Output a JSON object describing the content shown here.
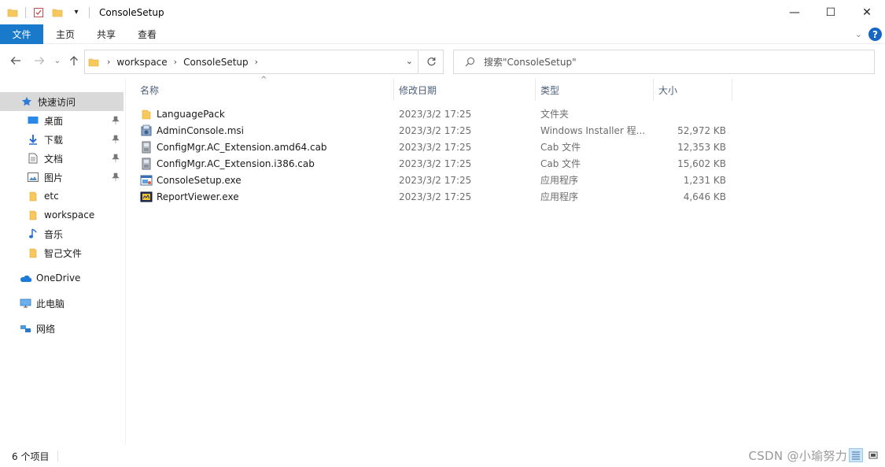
{
  "window": {
    "title": "ConsoleSetup",
    "controls": {
      "minimize": "—",
      "maximize": "☐",
      "close": "✕"
    }
  },
  "ribbon": {
    "tabs": [
      "文件",
      "主页",
      "共享",
      "查看"
    ],
    "help": "?"
  },
  "address": {
    "crumbs": [
      "workspace",
      "ConsoleSetup"
    ]
  },
  "search": {
    "placeholder": "搜索\"ConsoleSetup\""
  },
  "sidebar": {
    "quick_access": "快速访问",
    "pinned": [
      {
        "label": "桌面",
        "icon": "desktop-icon"
      },
      {
        "label": "下载",
        "icon": "download-icon"
      },
      {
        "label": "文档",
        "icon": "document-icon"
      },
      {
        "label": "图片",
        "icon": "pictures-icon"
      }
    ],
    "folders": [
      {
        "label": "etc",
        "icon": "folder-icon"
      },
      {
        "label": "workspace",
        "icon": "folder-icon"
      },
      {
        "label": "音乐",
        "icon": "music-icon"
      },
      {
        "label": "智己文件",
        "icon": "folder-icon"
      }
    ],
    "onedrive": "OneDrive",
    "this_pc": "此电脑",
    "network": "网络"
  },
  "columns": {
    "name": "名称",
    "modified": "修改日期",
    "type": "类型",
    "size": "大小"
  },
  "files": [
    {
      "name": "LanguagePack",
      "modified": "2023/3/2 17:25",
      "type": "文件夹",
      "size": "",
      "icon": "folder-icon"
    },
    {
      "name": "AdminConsole.msi",
      "modified": "2023/3/2 17:25",
      "type": "Windows Installer 程...",
      "size": "52,972 KB",
      "icon": "msi-installer-icon"
    },
    {
      "name": "ConfigMgr.AC_Extension.amd64.cab",
      "modified": "2023/3/2 17:25",
      "type": "Cab 文件",
      "size": "12,353 KB",
      "icon": "cab-archive-icon"
    },
    {
      "name": "ConfigMgr.AC_Extension.i386.cab",
      "modified": "2023/3/2 17:25",
      "type": "Cab 文件",
      "size": "15,602 KB",
      "icon": "cab-archive-icon"
    },
    {
      "name": "ConsoleSetup.exe",
      "modified": "2023/3/2 17:25",
      "type": "应用程序",
      "size": "1,231 KB",
      "icon": "setup-exe-icon"
    },
    {
      "name": "ReportViewer.exe",
      "modified": "2023/3/2 17:25",
      "type": "应用程序",
      "size": "4,646 KB",
      "icon": "report-exe-icon"
    }
  ],
  "status": {
    "count": "6 个项目",
    "watermark": "CSDN @小瑜努力"
  },
  "colors": {
    "accent": "#1979ca",
    "folder": "#f7c95c",
    "header_text": "#4c607a"
  }
}
